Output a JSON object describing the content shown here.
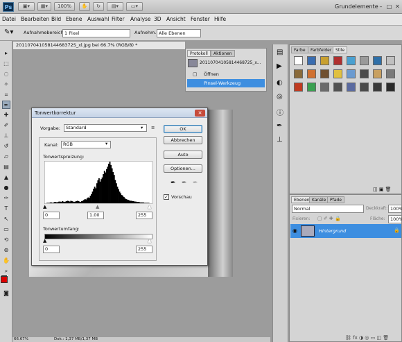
{
  "titlebar": {
    "logo": "Ps",
    "zoom": "100%",
    "workspace": "Grundelemente",
    "window_controls": [
      "–",
      "□",
      "✕"
    ]
  },
  "menu": [
    "Datei",
    "Bearbeiten",
    "Bild",
    "Ebene",
    "Auswahl",
    "Filter",
    "Analyse",
    "3D",
    "Ansicht",
    "Fenster",
    "Hilfe"
  ],
  "options": {
    "sample_size_label": "Aufnahmebereich:",
    "sample_size_value": "1 Pixel",
    "sample_label": "Aufnehm.:",
    "sample_value": "Alle Ebenen"
  },
  "document": {
    "tab": "20110704105814468372S_xl.jpg bei 66.7% (RGB/8) *"
  },
  "protokoll": {
    "tabs": [
      "Protokoll",
      "Aktionen"
    ],
    "snapshot": "20110704105814468725_x...",
    "items": [
      "Öffnen",
      "Pinsel-Werkzeug"
    ]
  },
  "styles": {
    "tabs": [
      "Farbe",
      "Farbfelder",
      "Stile"
    ]
  },
  "layers": {
    "tabs": [
      "Ebenen",
      "Kanäle",
      "Pfade"
    ],
    "blend": "Normal",
    "opacity_label": "Deckkraft:",
    "opacity": "100%",
    "fix_label": "Fixieren:",
    "fill_label": "Fläche:",
    "fill": "100%",
    "layer_name": "Hintergrund"
  },
  "dialog": {
    "title": "Tonwertkorrektur",
    "preset_label": "Vorgabe:",
    "preset_value": "Standard",
    "channel_label": "Kanal:",
    "channel_value": "RGB",
    "input_label": "Tonwertspreizung:",
    "input_values": [
      "0",
      "1.00",
      "255"
    ],
    "output_label": "Tonwertumfang:",
    "output_values": [
      "0",
      "255"
    ],
    "buttons": {
      "ok": "OK",
      "cancel": "Abbrechen",
      "auto": "Auto",
      "options": "Optionen..."
    },
    "preview": "Vorschau"
  },
  "histogram": [
    0,
    0,
    1,
    1,
    1,
    2,
    2,
    1,
    2,
    3,
    3,
    2,
    3,
    4,
    4,
    3,
    5,
    4,
    3,
    4,
    5,
    6,
    5,
    4,
    6,
    5,
    4,
    3,
    4,
    5,
    6,
    5,
    4,
    3,
    5,
    6,
    8,
    10,
    9,
    12,
    14,
    13,
    18,
    22,
    28,
    35,
    40,
    36,
    48,
    55,
    60,
    52,
    58,
    62,
    70,
    78,
    74,
    82,
    88,
    95,
    100,
    92,
    84,
    75,
    68,
    56,
    48,
    40,
    34,
    28,
    24,
    20,
    18,
    15,
    12,
    10,
    9,
    8,
    7,
    6,
    6,
    5,
    5,
    4,
    4,
    3,
    3,
    3,
    2,
    2,
    2,
    2,
    1,
    1,
    1,
    1,
    1,
    0,
    0,
    0
  ],
  "status": {
    "zoom": "66.67%",
    "doc": "Dok.: 1,37 MB/1,37 MB"
  }
}
